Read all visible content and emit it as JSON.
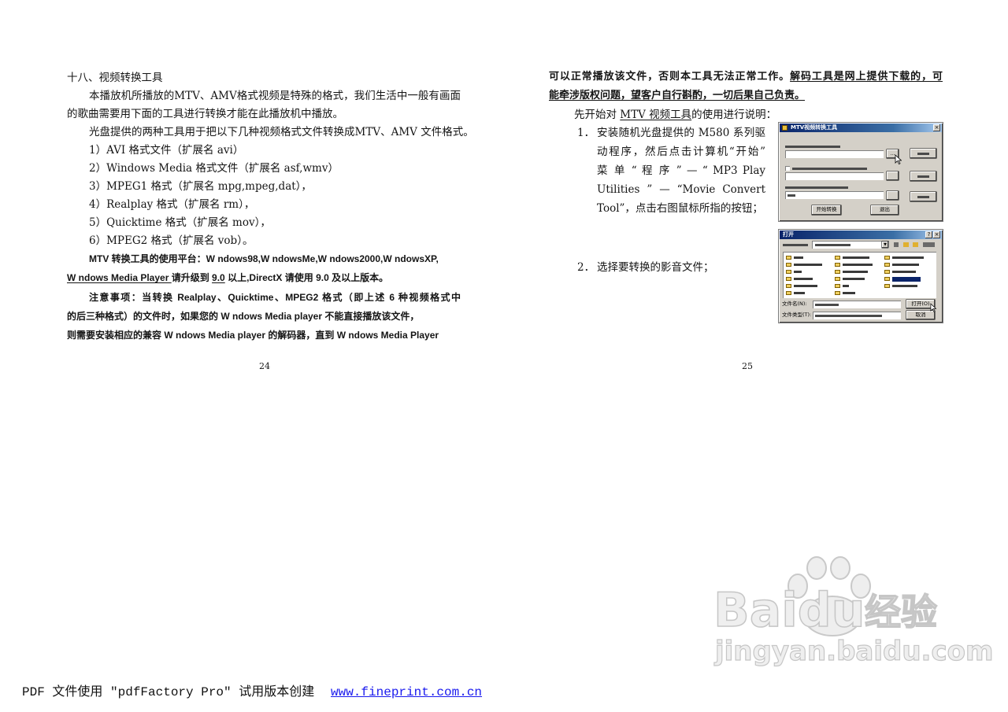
{
  "left_page": {
    "heading": "十八、视频转换工具",
    "intro_line1": "本播放机所播放的MTV、AMV格式视频是特殊的格式，我们生活中一般有画面",
    "intro_line2": "的歌曲需要用下面的工具进行转换才能在此播放机中播放。",
    "tools_line": "光盘提供的两种工具用于把以下几种视频格式文件转换成MTV、AMV 文件格式。",
    "formats": [
      "1）AVI 格式文件（扩展名 avi）",
      "2）Windows Media 格式文件（扩展名 asf,wmv）",
      "3）MPEG1 格式（扩展名 mpg,mpeg,dat），",
      "4）Realplay 格式（扩展名 rm），",
      "5）Quicktime 格式（扩展名 mov），",
      "6）MPEG2 格式（扩展名 vob）。"
    ],
    "platform_line1": "MTV 转换工具的使用平台：W ndows98,W ndowsMe,W ndows2000,W ndowsXP,",
    "platform_line2": {
      "player": "W ndows Media Player ",
      "upgrade": "请升级到 ",
      "version": "9.0",
      "rest": " 以上,DirectX 请使用 9.0 及以上版本。"
    },
    "note_lines": [
      "注意事项：当转换 Realplay、Quicktime、MPEG2 格式（即上述 6 种视频格式中",
      "的后三种格式）的文件时，如果您的 W ndows Media player 不能直接播放该文件，",
      "则需要安装相应的兼容 W ndows Media player 的解码器，直到 W ndows Media Player"
    ],
    "page_number": "24"
  },
  "right_page": {
    "line1_plain": "可以正常播放该文件，否则本工具无法正常工作。",
    "line1_underlined": "解码工具是网上提供下载的，可",
    "line2_underlined": "能牵涉版权问题，望客户自行斟酌，一切后果自己负责。",
    "intro_before": "先开始对 ",
    "intro_link": "MTV 视频工具",
    "intro_after": "的使用进行说明：",
    "steps": [
      {
        "number": "1．",
        "lines": [
          "安装随机光盘提供的 M580 系列驱",
          "动程序，然后点击计算机“开始”",
          "菜 单 “ 程 序 ” — “ MP3 Play",
          "Utilities ” — “Movie Convert",
          "Tool”，点击右图鼠标所指的按钮；"
        ]
      },
      {
        "number": "2．",
        "lines": [
          "选择要转换的影音文件；"
        ]
      }
    ],
    "dialog1": {
      "title": "MTV视频转换工具",
      "start_button": "开始转换",
      "exit_button": "退出",
      "browse_button": "..."
    },
    "dialog2": {
      "title": "打开",
      "filename_label": "文件名(N):",
      "filetype_label": "文件类型(T):",
      "open_button": "打开(O)",
      "cancel_button": "取消"
    },
    "page_number": "25"
  },
  "watermark": {
    "brand": "Baidu",
    "product": "经验",
    "url": "jingyan.baidu.com"
  },
  "footer": {
    "text": "PDF 文件使用 \"pdfFactory Pro\" 试用版本创建",
    "link": "www.fineprint.com.cn",
    "link_color": "#1a1aee"
  }
}
